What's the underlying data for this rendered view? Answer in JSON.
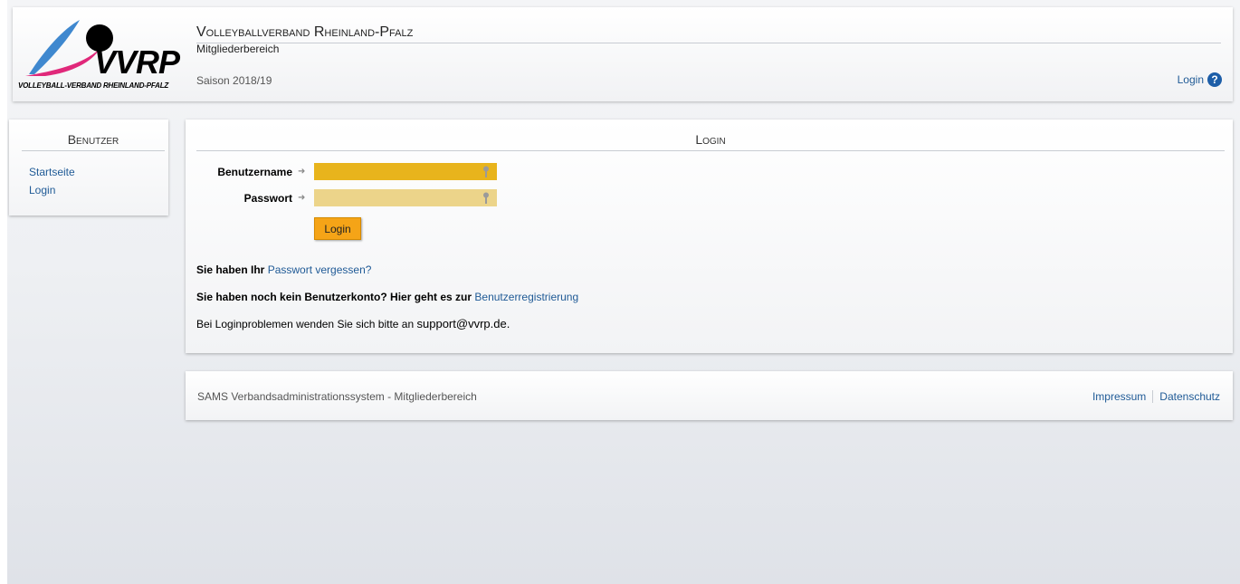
{
  "header": {
    "logo_text": "VVRP",
    "logo_sub": "VOLLEYBALL-VERBAND RHEINLAND-PFALZ",
    "org_title": "Volleyballverband Rheinland-Pfalz",
    "org_sub": "Mitgliederbereich",
    "season": "Saison 2018/19",
    "login_label": "Login",
    "help_glyph": "?"
  },
  "sidebar": {
    "title": "Benutzer",
    "items": [
      {
        "label": "Startseite"
      },
      {
        "label": "Login"
      }
    ]
  },
  "login": {
    "title": "Login",
    "username_label": "Benutzername",
    "password_label": "Passwort",
    "username_value": "",
    "password_value": "",
    "button_label": "Login",
    "forgot_prefix": "Sie haben Ihr",
    "forgot_link": "Passwort vergessen?",
    "register_prefix": "Sie haben noch kein Benutzerkonto? Hier geht es zur",
    "register_link": "Benutzerregistrierung",
    "support_text": "Bei Loginproblemen wenden Sie sich bitte an",
    "support_email": "support@vvrp.de."
  },
  "footer": {
    "text": "SAMS Verbandsadministrationssystem - Mitgliederbereich",
    "impressum": "Impressum",
    "datenschutz": "Datenschutz"
  },
  "colors": {
    "username_field": "#e8b41c",
    "password_field": "#ecd48a",
    "button": "#f5a417",
    "link": "#1f5a96",
    "help_icon": "#1d5ea8"
  }
}
